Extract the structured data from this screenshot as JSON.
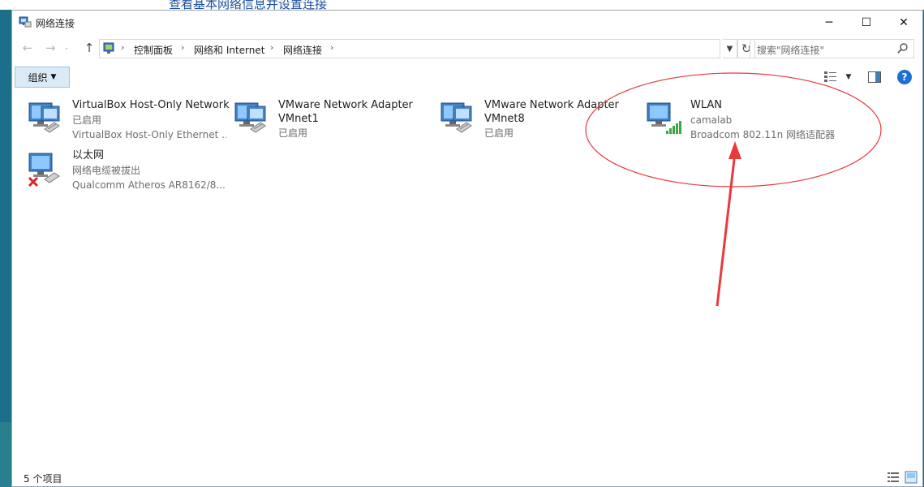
{
  "background": {
    "window_title_fragment": "查看基本网络信息并设置连接"
  },
  "window": {
    "title": "网络连接",
    "controls": {
      "minimize": "─",
      "maximize": "☐",
      "close": "✕"
    }
  },
  "address": {
    "breadcrumbs": [
      "控制面板",
      "网络和 Internet",
      "网络连接"
    ],
    "search_placeholder": "搜索\"网络连接\""
  },
  "toolbar": {
    "organize_label": "组织"
  },
  "connections": [
    {
      "name": "VirtualBox Host-Only Network",
      "name2": "",
      "status": "已启用",
      "adapter": "VirtualBox Host-Only Ethernet ...",
      "icon": "wired-network-icon"
    },
    {
      "name": "VMware Network Adapter",
      "name2": "VMnet1",
      "status": "已启用",
      "adapter": "",
      "icon": "wired-network-icon"
    },
    {
      "name": "VMware Network Adapter",
      "name2": "VMnet8",
      "status": "已启用",
      "adapter": "",
      "icon": "wired-network-icon"
    },
    {
      "name": "WLAN",
      "name2": "",
      "status": "camalab",
      "adapter": "Broadcom 802.11n 网络适配器",
      "icon": "wifi-network-icon"
    },
    {
      "name": "以太网",
      "name2": "",
      "status": "网络电缆被拔出",
      "adapter": "Qualcomm Atheros AR8162/8...",
      "icon": "disconnected-network-icon"
    }
  ],
  "status_bar": {
    "item_count": "5 个项目"
  },
  "colors": {
    "accent": "#1e6fd1",
    "annotation": "#e8393c",
    "signal": "#3aa845",
    "error": "#d9252a"
  }
}
